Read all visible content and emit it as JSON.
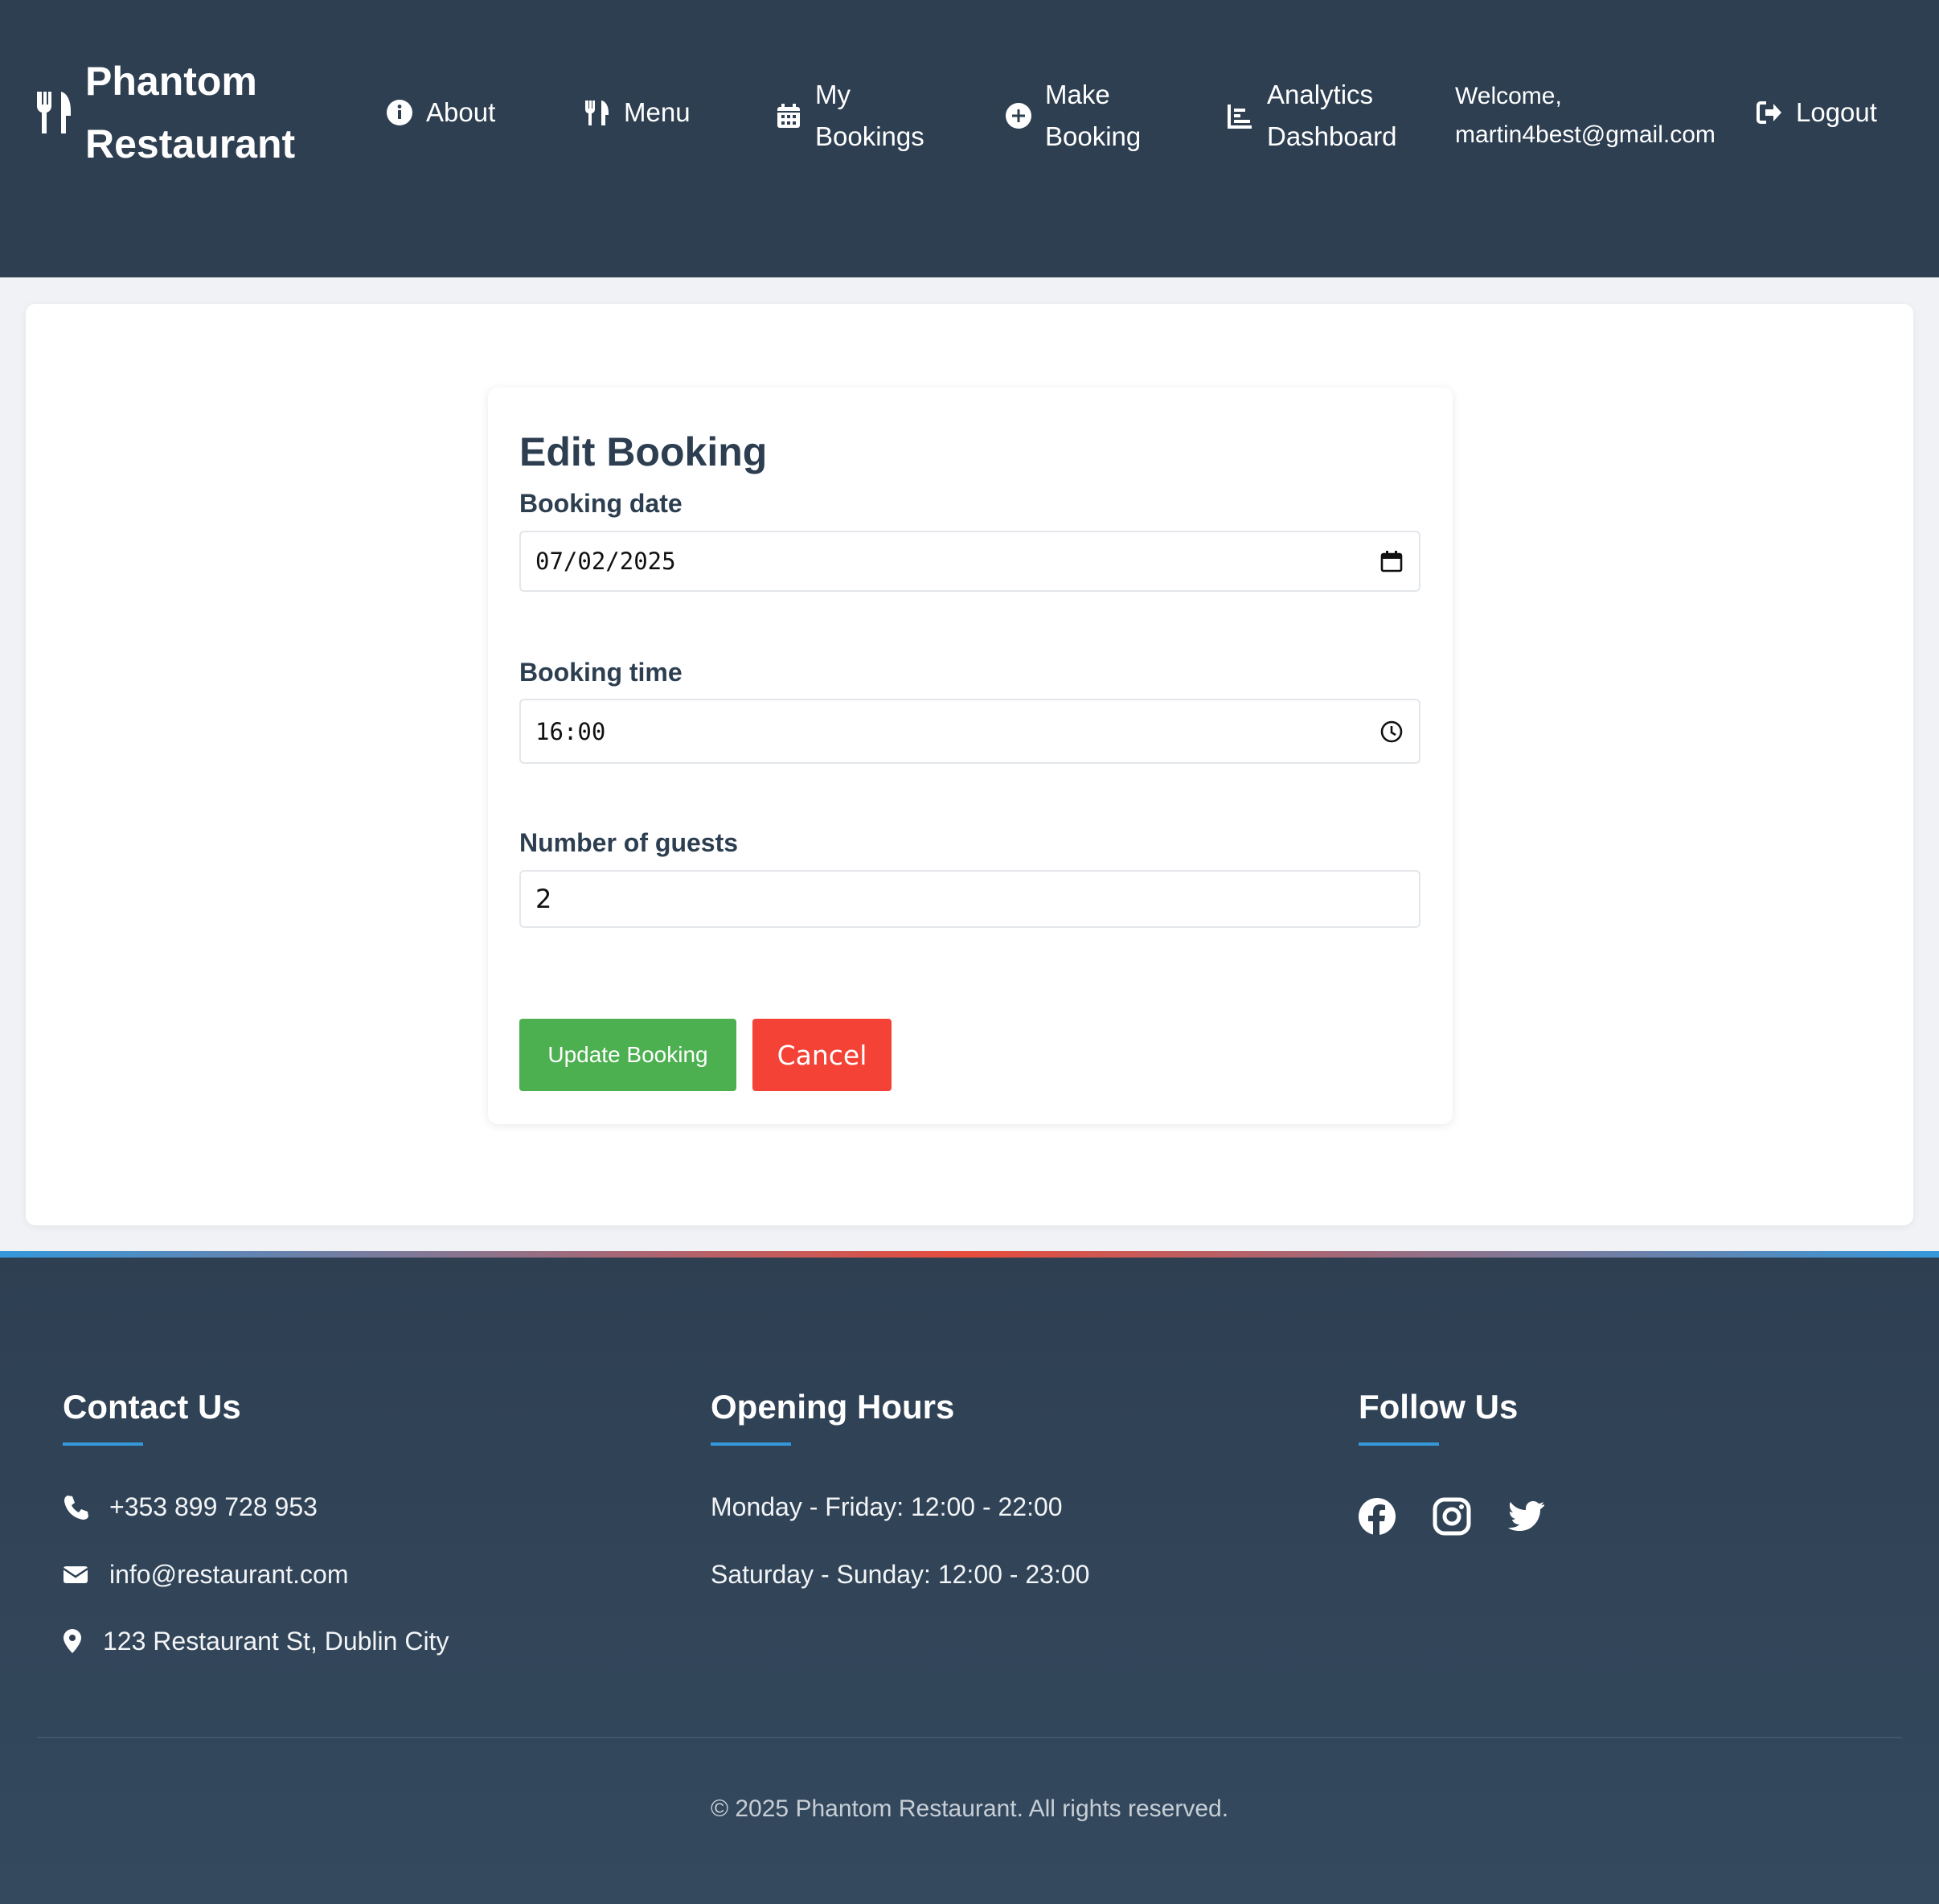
{
  "header": {
    "brand": "Phantom Restaurant",
    "logo_icon": "utensils-icon",
    "nav": [
      {
        "label": "About",
        "icon": "info-circle-icon"
      },
      {
        "label": "Menu",
        "icon": "utensils-icon"
      },
      {
        "label": "My Bookings",
        "icon": "calendar-icon"
      },
      {
        "label": "Make Booking",
        "icon": "plus-circle-icon"
      },
      {
        "label": "Analytics Dashboard",
        "icon": "chart-bar-icon"
      }
    ],
    "welcome": "Welcome, martin4best@gmail.com",
    "logout": {
      "label": "Logout",
      "icon": "sign-out-icon"
    }
  },
  "form": {
    "title": "Edit Booking",
    "date_label": "Booking date",
    "date_value": "07/02/2025",
    "time_label": "Booking time",
    "time_value": "16:00",
    "guests_label": "Number of guests",
    "guests_value": "2",
    "update_label": "Update Booking",
    "cancel_label": "Cancel"
  },
  "footer": {
    "contact_heading": "Contact Us",
    "phone": "+353 899 728 953",
    "email": "info@restaurant.com",
    "address": "123 Restaurant St, Dublin City",
    "hours_heading": "Opening Hours",
    "hours": [
      "Monday - Friday: 12:00 - 22:00",
      "Saturday - Sunday: 12:00 - 23:00"
    ],
    "follow_heading": "Follow Us",
    "social": [
      "facebook-icon",
      "instagram-icon",
      "twitter-icon"
    ],
    "copyright": "© 2025 Phantom Restaurant. All rights reserved."
  },
  "colors": {
    "header_bg": "#2e3f52",
    "update_button": "#4caf50",
    "cancel_button": "#f44336",
    "accent": "#3498db"
  }
}
